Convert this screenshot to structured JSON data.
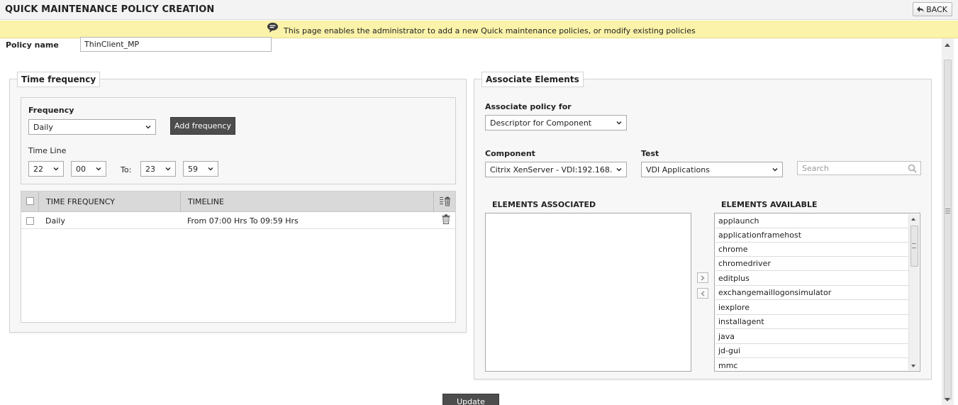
{
  "header": {
    "title": "QUICK MAINTENANCE POLICY CREATION",
    "back_label": "BACK"
  },
  "info_banner": {
    "text": "This page enables the administrator to add a new Quick maintenance policies, or modify existing policies"
  },
  "policy": {
    "label": "Policy name",
    "value": "ThinClient_MP"
  },
  "time_frequency": {
    "legend": "Time frequency",
    "frequency_label": "Frequency",
    "frequency_value": "Daily",
    "add_button": "Add frequency",
    "timeline_label": "Time Line",
    "from_hour": "22",
    "from_minute": "00",
    "to_label": "To:",
    "to_hour": "23",
    "to_minute": "59",
    "table": {
      "headers": [
        "TIME FREQUENCY",
        "TIMELINE"
      ],
      "rows": [
        {
          "frequency": "Daily",
          "timeline": "From 07:00 Hrs To 09:59 Hrs"
        }
      ]
    }
  },
  "associate": {
    "legend": "Associate Elements",
    "policy_for_label": "Associate policy for",
    "policy_for_value": "Descriptor for Component",
    "component_label": "Component",
    "component_value": "Citrix XenServer - VDI:192.168.",
    "test_label": "Test",
    "test_value": "VDI Applications",
    "search_placeholder": "Search",
    "associated_header": "ELEMENTS ASSOCIATED",
    "available_header": "ELEMENTS AVAILABLE",
    "available": [
      "applaunch",
      "applicationframehost",
      "chrome",
      "chromedriver",
      "editplus",
      "exchangemaillogonsimulator",
      "iexplore",
      "installagent",
      "java",
      "jd-gui",
      "mmc"
    ]
  },
  "footer": {
    "update_label": "Update"
  },
  "colors": {
    "banner": "#fbf3a9",
    "dark_button": "#4d4d4d",
    "panel_bg": "#f7f7f7"
  },
  "icons": [
    "back-arrow-icon",
    "speech-bubble-icon",
    "chevron-down-icon",
    "trash-icon",
    "column-settings-icon",
    "search-icon",
    "arrow-right-icon",
    "arrow-left-icon"
  ]
}
